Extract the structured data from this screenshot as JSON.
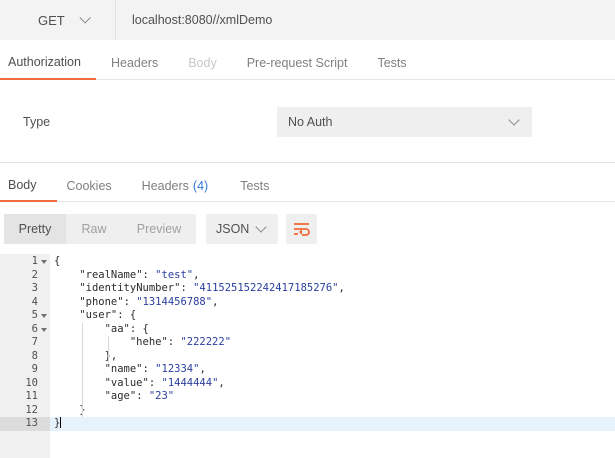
{
  "request": {
    "method": "GET",
    "url": "localhost:8080//xmlDemo"
  },
  "request_tabs": [
    {
      "label": "Authorization",
      "state": "active"
    },
    {
      "label": "Headers",
      "state": "normal"
    },
    {
      "label": "Body",
      "state": "disabled"
    },
    {
      "label": "Pre-request Script",
      "state": "normal"
    },
    {
      "label": "Tests",
      "state": "normal"
    }
  ],
  "auth": {
    "type_label": "Type",
    "type_value": "No Auth"
  },
  "response_tabs": [
    {
      "label": "Body",
      "state": "active"
    },
    {
      "label": "Cookies",
      "state": "normal"
    },
    {
      "label": "Headers",
      "count": "(4)",
      "state": "normal"
    },
    {
      "label": "Tests",
      "state": "normal"
    }
  ],
  "format": {
    "modes": [
      {
        "label": "Pretty",
        "active": true
      },
      {
        "label": "Raw",
        "active": false
      },
      {
        "label": "Preview",
        "active": false
      }
    ],
    "language": "JSON",
    "wrap_icon": "wrap-lines-icon"
  },
  "editor": {
    "current_line": 13,
    "lines": [
      {
        "n": "1",
        "fold": true,
        "tokens": [
          {
            "t": "p",
            "v": "{"
          }
        ]
      },
      {
        "n": "2",
        "fold": false,
        "tokens": [
          {
            "t": "p",
            "v": "    "
          },
          {
            "t": "k",
            "v": "\"realName\""
          },
          {
            "t": "p",
            "v": ": "
          },
          {
            "t": "s",
            "v": "\"test\""
          },
          {
            "t": "p",
            "v": ","
          }
        ]
      },
      {
        "n": "3",
        "fold": false,
        "tokens": [
          {
            "t": "p",
            "v": "    "
          },
          {
            "t": "k",
            "v": "\"identityNumber\""
          },
          {
            "t": "p",
            "v": ": "
          },
          {
            "t": "s",
            "v": "\"411525152242417185276\""
          },
          {
            "t": "p",
            "v": ","
          }
        ]
      },
      {
        "n": "4",
        "fold": false,
        "tokens": [
          {
            "t": "p",
            "v": "    "
          },
          {
            "t": "k",
            "v": "\"phone\""
          },
          {
            "t": "p",
            "v": ": "
          },
          {
            "t": "s",
            "v": "\"1314456788\""
          },
          {
            "t": "p",
            "v": ","
          }
        ]
      },
      {
        "n": "5",
        "fold": true,
        "tokens": [
          {
            "t": "p",
            "v": "    "
          },
          {
            "t": "k",
            "v": "\"user\""
          },
          {
            "t": "p",
            "v": ": {"
          }
        ]
      },
      {
        "n": "6",
        "fold": true,
        "tokens": [
          {
            "t": "p",
            "v": "        "
          },
          {
            "t": "k",
            "v": "\"aa\""
          },
          {
            "t": "p",
            "v": ": {"
          }
        ]
      },
      {
        "n": "7",
        "fold": false,
        "tokens": [
          {
            "t": "p",
            "v": "            "
          },
          {
            "t": "k",
            "v": "\"hehe\""
          },
          {
            "t": "p",
            "v": ": "
          },
          {
            "t": "s",
            "v": "\"222222\""
          }
        ]
      },
      {
        "n": "8",
        "fold": false,
        "tokens": [
          {
            "t": "p",
            "v": "        },"
          }
        ]
      },
      {
        "n": "9",
        "fold": false,
        "tokens": [
          {
            "t": "p",
            "v": "        "
          },
          {
            "t": "k",
            "v": "\"name\""
          },
          {
            "t": "p",
            "v": ": "
          },
          {
            "t": "s",
            "v": "\"12334\""
          },
          {
            "t": "p",
            "v": ","
          }
        ]
      },
      {
        "n": "10",
        "fold": false,
        "tokens": [
          {
            "t": "p",
            "v": "        "
          },
          {
            "t": "k",
            "v": "\"value\""
          },
          {
            "t": "p",
            "v": ": "
          },
          {
            "t": "s",
            "v": "\"1444444\""
          },
          {
            "t": "p",
            "v": ","
          }
        ]
      },
      {
        "n": "11",
        "fold": false,
        "tokens": [
          {
            "t": "p",
            "v": "        "
          },
          {
            "t": "k",
            "v": "\"age\""
          },
          {
            "t": "p",
            "v": ": "
          },
          {
            "t": "s",
            "v": "\"23\""
          }
        ]
      },
      {
        "n": "12",
        "fold": false,
        "tokens": [
          {
            "t": "p",
            "v": "    }"
          }
        ]
      },
      {
        "n": "13",
        "fold": false,
        "tokens": [
          {
            "t": "p",
            "v": "}"
          }
        ]
      }
    ]
  },
  "colors": {
    "accent": "#f26b3a",
    "count": "#2f7bd8",
    "string": "#2a3f9f"
  }
}
